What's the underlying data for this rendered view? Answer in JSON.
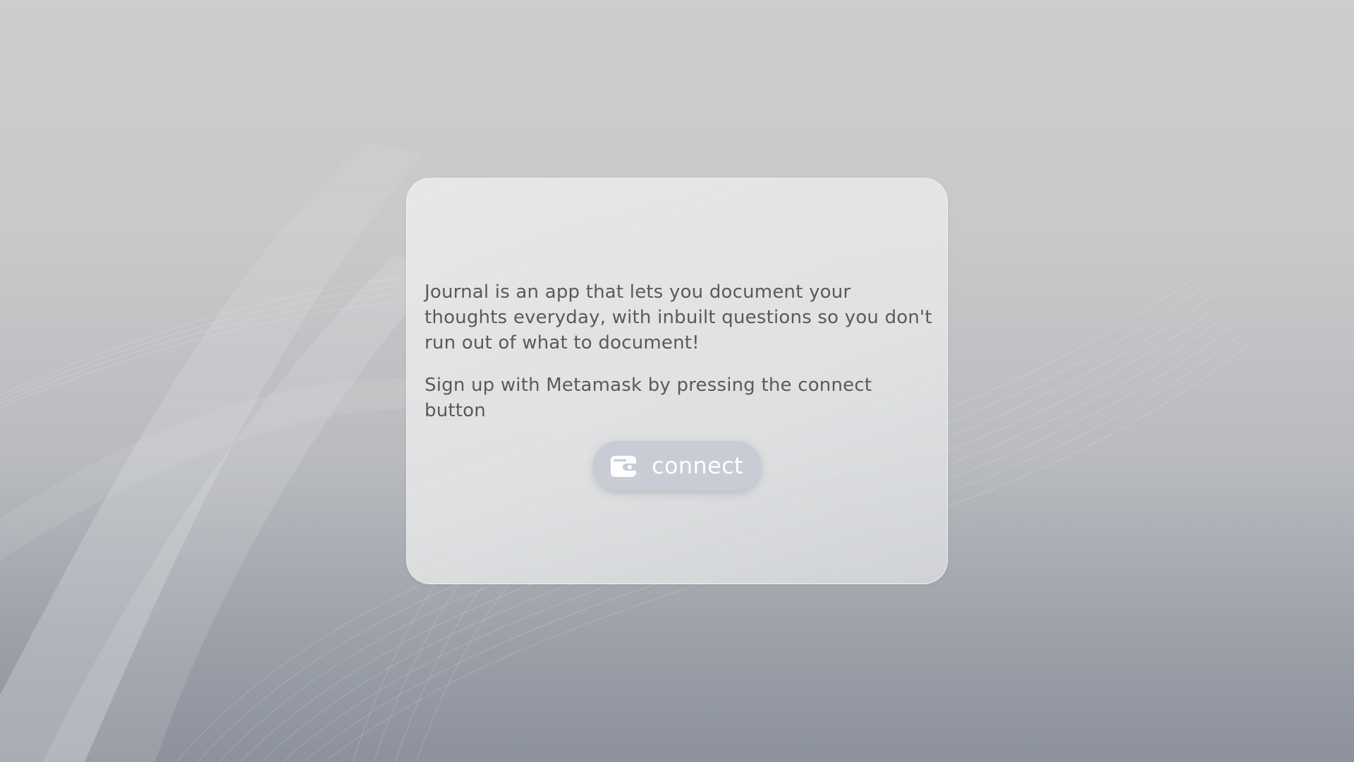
{
  "card": {
    "description": "Journal is an app that lets you document your thoughts everyday, with inbuilt questions so you don't run out of what to document!",
    "instruction": "Sign up with Metamask by pressing the connect button"
  },
  "connect_button": {
    "label": "connect",
    "icon": "wallet-icon"
  },
  "colors": {
    "text": "#5a5a5a",
    "button_bg": "#c7ccd5",
    "button_text": "#ffffff"
  }
}
